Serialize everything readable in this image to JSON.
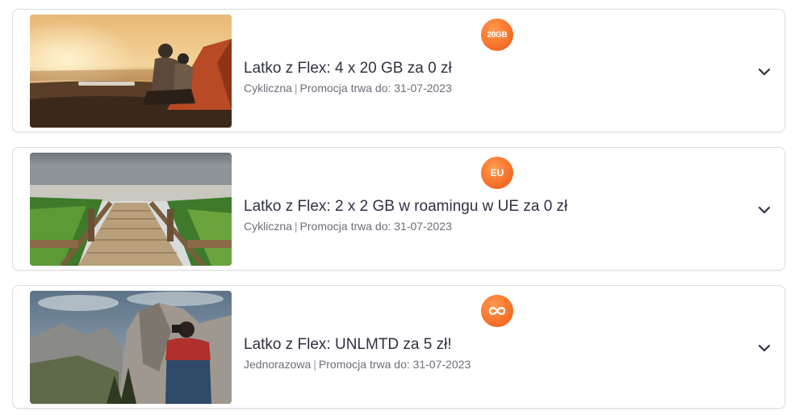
{
  "offers": [
    {
      "badge": "20GB",
      "badge_icon": "20gb-badge-icon",
      "title": "Latko z Flex: 4 x 20 GB za 0 zł",
      "type": "Cykliczna",
      "separator": "|",
      "promo_text": "Promocja trwa do: 31-07-2023",
      "image": "sunset-beach-tent-couple-image"
    },
    {
      "badge": "EU",
      "badge_icon": "eu-badge-icon",
      "title": "Latko z Flex: 2 x 2 GB w roamingu w UE za 0 zł",
      "type": "Cykliczna",
      "separator": "|",
      "promo_text": "Promocja trwa do: 31-07-2023",
      "image": "beach-boardwalk-stairs-image"
    },
    {
      "badge": "",
      "badge_icon": "infinity-icon",
      "title": "Latko z Flex: UNLMTD za 5 zł!",
      "type": "Jednorazowa",
      "separator": "|",
      "promo_text": "Promocja trwa do: 31-07-2023",
      "image": "mountain-photographer-image"
    }
  ],
  "colors": {
    "badge_orange": "#f8742b",
    "title_text": "#2f3142",
    "subtitle_text": "#6c6e78",
    "card_border": "#dcdde3"
  }
}
